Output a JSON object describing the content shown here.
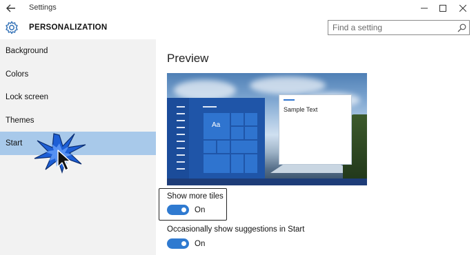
{
  "window": {
    "title": "Settings",
    "back_icon": "back-arrow-icon",
    "controls": [
      "minimize-icon",
      "maximize-icon",
      "close-icon"
    ]
  },
  "header": {
    "icon": "gear-icon",
    "title": "PERSONALIZATION"
  },
  "search": {
    "placeholder": "Find a setting",
    "value": "",
    "icon": "search-icon"
  },
  "sidebar": {
    "items": [
      {
        "label": "Background",
        "selected": false
      },
      {
        "label": "Colors",
        "selected": false
      },
      {
        "label": "Lock screen",
        "selected": false
      },
      {
        "label": "Themes",
        "selected": false
      },
      {
        "label": "Start",
        "selected": true
      }
    ]
  },
  "main": {
    "preview_title": "Preview",
    "preview": {
      "tile_label": "Aa",
      "window_text": "Sample Text"
    },
    "settings": [
      {
        "label": "Show more tiles",
        "state": "On",
        "on": true
      },
      {
        "label": "Occasionally show suggestions in Start",
        "state": "On",
        "on": true
      }
    ]
  },
  "colors": {
    "accent": "#2f7ad0",
    "selected_nav": "#a8c9ea",
    "sidebar_bg": "#f2f2f2"
  }
}
